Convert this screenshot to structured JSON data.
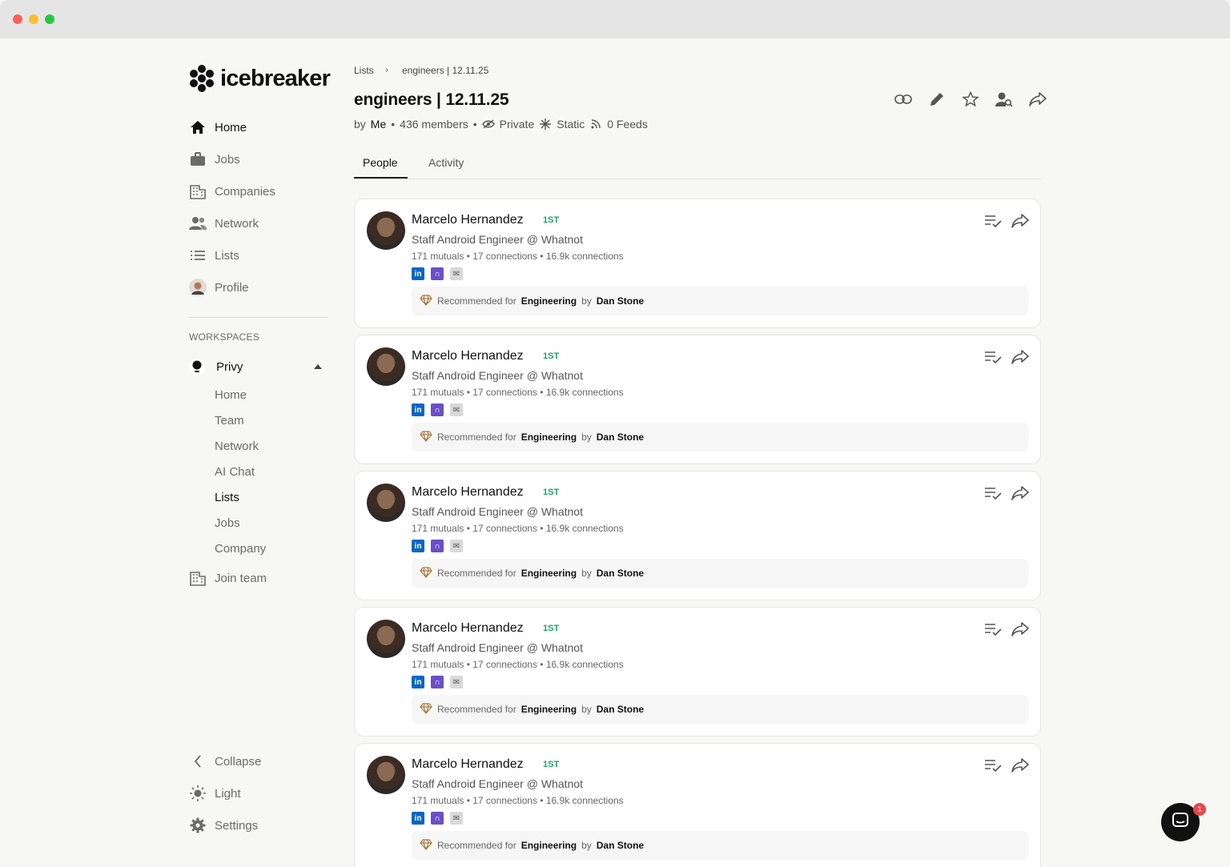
{
  "brand": {
    "name": "icebreaker"
  },
  "sidebar": {
    "items": [
      {
        "label": "Home",
        "icon": "home-icon"
      },
      {
        "label": "Jobs",
        "icon": "briefcase-icon"
      },
      {
        "label": "Companies",
        "icon": "building-icon"
      },
      {
        "label": "Network",
        "icon": "people-icon"
      },
      {
        "label": "Lists",
        "icon": "list-icon"
      },
      {
        "label": "Profile",
        "icon": "avatar-icon"
      }
    ],
    "workspaces_label": "WORKSPACES",
    "workspace": {
      "name": "Privy",
      "sub_items": [
        "Home",
        "Team",
        "Network",
        "AI Chat",
        "Lists",
        "Jobs",
        "Company"
      ]
    },
    "join_team": "Join team",
    "bottom": {
      "collapse": "Collapse",
      "light": "Light",
      "settings": "Settings"
    }
  },
  "breadcrumb": {
    "root": "Lists",
    "current": "engineers | 12.11.25"
  },
  "list": {
    "title": "engineers | 12.11.25",
    "by_prefix": "by",
    "owner": "Me",
    "members": "436 members",
    "privacy": "Private",
    "type": "Static",
    "feeds": "0 Feeds"
  },
  "tabs": [
    {
      "label": "People",
      "active": true
    },
    {
      "label": "Activity",
      "active": false
    }
  ],
  "people": [
    {
      "name": "Marcelo Hernandez",
      "degree": "1ST",
      "role": "Staff Android Engineer @ Whatnot",
      "stats": "171 mutuals • 17 connections • 16.9k connections",
      "rec_prefix": "Recommended for",
      "rec_team": "Engineering",
      "rec_by": "by",
      "rec_person": "Dan Stone"
    },
    {
      "name": "Marcelo Hernandez",
      "degree": "1ST",
      "role": "Staff Android Engineer @ Whatnot",
      "stats": "171 mutuals • 17 connections • 16.9k connections",
      "rec_prefix": "Recommended for",
      "rec_team": "Engineering",
      "rec_by": "by",
      "rec_person": "Dan Stone"
    },
    {
      "name": "Marcelo Hernandez",
      "degree": "1ST",
      "role": "Staff Android Engineer @ Whatnot",
      "stats": "171 mutuals • 17 connections • 16.9k connections",
      "rec_prefix": "Recommended for",
      "rec_team": "Engineering",
      "rec_by": "by",
      "rec_person": "Dan Stone"
    },
    {
      "name": "Marcelo Hernandez",
      "degree": "1ST",
      "role": "Staff Android Engineer @ Whatnot",
      "stats": "171 mutuals • 17 connections • 16.9k connections",
      "rec_prefix": "Recommended for",
      "rec_team": "Engineering",
      "rec_by": "by",
      "rec_person": "Dan Stone"
    },
    {
      "name": "Marcelo Hernandez",
      "degree": "1ST",
      "role": "Staff Android Engineer @ Whatnot",
      "stats": "171 mutuals • 17 connections • 16.9k connections",
      "rec_prefix": "Recommended for",
      "rec_team": "Engineering",
      "rec_by": "by",
      "rec_person": "Dan Stone"
    }
  ],
  "chat": {
    "badge": "1"
  },
  "colors": {
    "degree": "#1ea36a",
    "linkedin": "#0a66c2",
    "icebreaker": "#6a4fc8",
    "badge": "#e5484d"
  }
}
